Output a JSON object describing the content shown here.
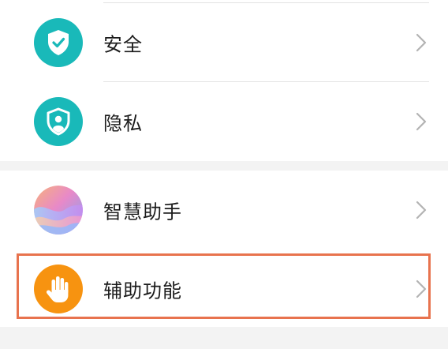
{
  "settings": {
    "items": [
      {
        "label": "安全",
        "icon": "shield-check-icon",
        "color": "#19b9b9"
      },
      {
        "label": "隐私",
        "icon": "shield-user-icon",
        "color": "#19b9b9"
      },
      {
        "label": "智慧助手",
        "icon": "smart-assistant-icon",
        "color": "gradient"
      },
      {
        "label": "辅助功能",
        "icon": "hand-icon",
        "color": "#f79310"
      }
    ],
    "highlighted_item": "辅助功能",
    "highlight_color": "#e8734e",
    "chevron_icon": "chevron-right-icon"
  }
}
